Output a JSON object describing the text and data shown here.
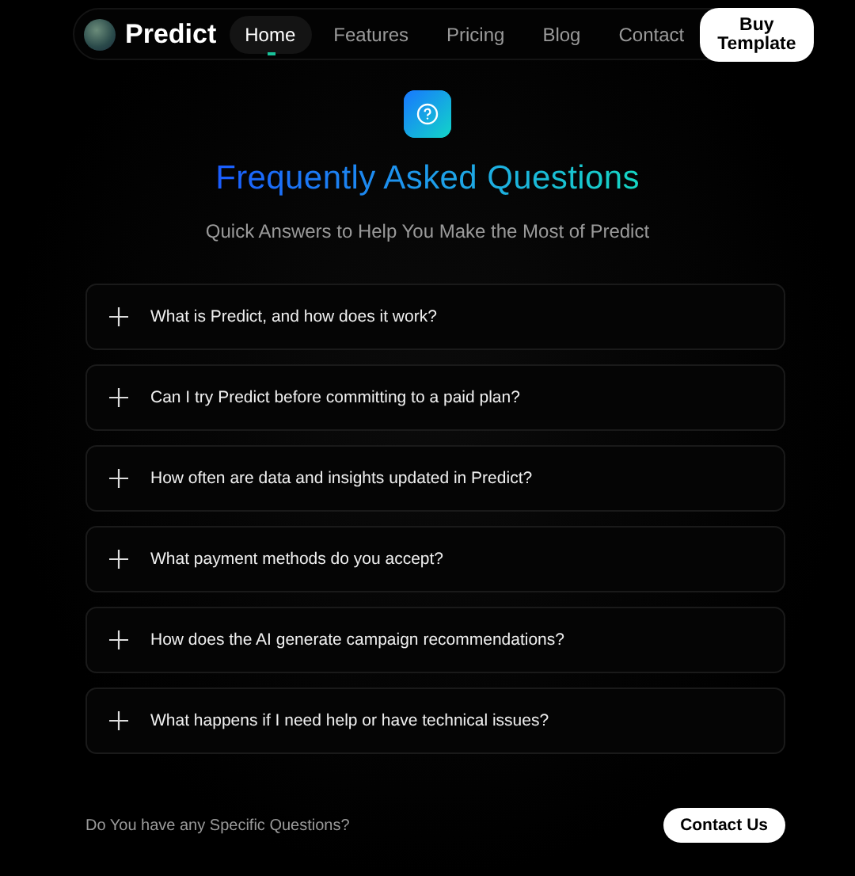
{
  "nav": {
    "brand": "Predict",
    "links": [
      {
        "label": "Home",
        "selected": true
      },
      {
        "label": "Features",
        "selected": false
      },
      {
        "label": "Pricing",
        "selected": false
      },
      {
        "label": "Blog",
        "selected": false
      },
      {
        "label": "Contact",
        "selected": false
      }
    ],
    "cta": "Buy Template"
  },
  "hero": {
    "title": "Frequently Asked Questions",
    "subtitle": "Quick Answers to Help You Make the Most of Predict"
  },
  "faq": [
    {
      "question": "What is Predict, and how does it work?",
      "expanded": false
    },
    {
      "question": "Can I try Predict before committing to a paid plan?",
      "expanded": false
    },
    {
      "question": "How often are data and insights updated in Predict?",
      "expanded": false
    },
    {
      "question": "What payment methods do you accept?",
      "expanded": false
    },
    {
      "question": "How does the AI generate campaign recommendations?",
      "expanded": false
    },
    {
      "question": "What happens if I need help or have technical issues?",
      "expanded": false
    }
  ],
  "footer": {
    "prompt": "Do You have any Specific Questions?",
    "button": "Contact Us"
  }
}
